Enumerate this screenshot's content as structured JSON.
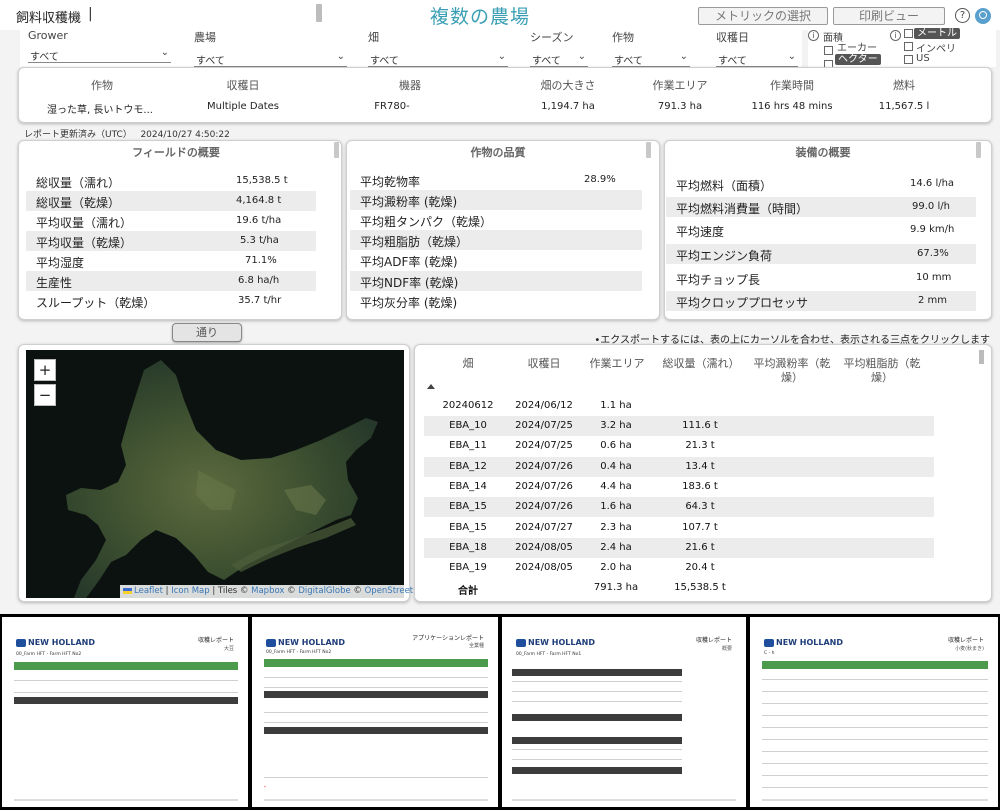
{
  "header": {
    "app_name": "飼料収穫機",
    "separator": "|",
    "page_title": "複数の農場",
    "metric_button": "メトリックの選択",
    "print_button": "印刷ビュー",
    "help": "?"
  },
  "filters": [
    {
      "label": "Grower",
      "value": "すべて"
    },
    {
      "label": "農場",
      "value": "すべて"
    },
    {
      "label": "畑",
      "value": "すべて"
    },
    {
      "label": "シーズン",
      "value": "すべて"
    },
    {
      "label": "作物",
      "value": "すべて"
    },
    {
      "label": "収穫日",
      "value": "すべて"
    }
  ],
  "area_units": {
    "label": "面積",
    "options": [
      {
        "label": "エーカー",
        "selected": false
      },
      {
        "label": "ヘクター",
        "selected": true
      }
    ]
  },
  "length_units": {
    "options": [
      {
        "label": "メートル",
        "selected": true
      },
      {
        "label": "インペリ",
        "selected": false
      },
      {
        "label": "US",
        "selected": false
      }
    ]
  },
  "summary": {
    "headers": [
      "作物",
      "収穫日",
      "機器",
      "畑の大きさ",
      "作業エリア",
      "作業時間",
      "燃料"
    ],
    "values": [
      "湿った草, 長いトウモ...",
      "Multiple Dates",
      "FR780-",
      "1,194.7 ha",
      "791.3 ha",
      "116 hrs 48 mins",
      "11,567.5 l"
    ]
  },
  "updated": {
    "label": "レポート更新済み（UTC）",
    "value": "2024/10/27 4:50:22"
  },
  "field_overview": {
    "title": "フィールドの概要",
    "rows": [
      {
        "k": "総収量（濡れ）",
        "v": "15,538.5 t"
      },
      {
        "k": "総収量（乾燥）",
        "v": "4,164.8 t"
      },
      {
        "k": "平均収量（濡れ）",
        "v": "19.6 t/ha"
      },
      {
        "k": "平均収量（乾燥）",
        "v": "5.3 t/ha"
      },
      {
        "k": "平均湿度",
        "v": "71.1%"
      },
      {
        "k": "生産性",
        "v": "6.8 ha/h"
      },
      {
        "k": "スループット（乾燥）",
        "v": "35.7 t/hr"
      }
    ]
  },
  "crop_quality": {
    "title": "作物の品質",
    "rows": [
      {
        "k": "平均乾物率",
        "v": "28.9%"
      },
      {
        "k": "平均澱粉率 (乾燥)",
        "v": ""
      },
      {
        "k": "平均粗タンパク（乾燥）",
        "v": ""
      },
      {
        "k": "平均粗脂肪（乾燥）",
        "v": ""
      },
      {
        "k": "平均ADF率 (乾燥)",
        "v": ""
      },
      {
        "k": "平均NDF率 (乾燥)",
        "v": ""
      },
      {
        "k": "平均灰分率 (乾燥)",
        "v": ""
      }
    ]
  },
  "equipment": {
    "title": "装備の概要",
    "rows": [
      {
        "k": "平均燃料（面積）",
        "v": "14.6 l/ha"
      },
      {
        "k": "平均燃料消費量（時間）",
        "v": "99.0 l/h"
      },
      {
        "k": "平均速度",
        "v": "9.9 km/h"
      },
      {
        "k": "平均エンジン負荷",
        "v": "67.3%"
      },
      {
        "k": "平均チョップ長",
        "v": "10 mm"
      },
      {
        "k": "平均クロッププロセッサ",
        "v": "2 mm"
      }
    ]
  },
  "passes_button": "通り",
  "export_note": "•エクスポートするには、表の上にカーソルを合わせ、表示される三点をクリックします",
  "map": {
    "zoom_in": "+",
    "zoom_out": "−",
    "attrib_leaflet": "Leaflet",
    "attrib_sep1": " | ",
    "attrib_iconmap": "Icon Map",
    "attrib_tiles": " | Tiles © ",
    "attrib_mapbox": "Mapbox",
    "attrib_copy1": " © ",
    "attrib_dg": "DigitalGlobe",
    "attrib_copy2": " © ",
    "attrib_osm": "OpenStreetMap"
  },
  "field_table": {
    "headers": [
      "畑",
      "収穫日",
      "作業エリア",
      "総収量（濡れ）",
      "平均澱粉率（乾燥）",
      "平均粗脂肪（乾燥）"
    ],
    "rows": [
      [
        "20240612",
        "2024/06/12",
        "1.1 ha",
        ""
      ],
      [
        "EBA_10",
        "2024/07/25",
        "3.2 ha",
        "111.6 t"
      ],
      [
        "EBA_11",
        "2024/07/25",
        "0.6 ha",
        "21.3 t"
      ],
      [
        "EBA_12",
        "2024/07/26",
        "0.4 ha",
        "13.4 t"
      ],
      [
        "EBA_14",
        "2024/07/26",
        "4.4 ha",
        "183.6 t"
      ],
      [
        "EBA_15",
        "2024/07/26",
        "1.6 ha",
        "64.3 t"
      ],
      [
        "EBA_15",
        "2024/07/27",
        "2.3 ha",
        "107.7 t"
      ],
      [
        "EBA_18",
        "2024/08/05",
        "2.4 ha",
        "21.6 t"
      ],
      [
        "EBA_19",
        "2024/08/05",
        "2.0 ha",
        "20.4 t"
      ]
    ],
    "total": [
      "合計",
      "",
      "791.3 ha",
      "15,538.5 t"
    ]
  },
  "reports": [
    {
      "brand": "NEW HOLLAND",
      "title": "収穫レポート",
      "sub": "大豆",
      "farm": "00_Farm HFT - Farm HFT No2"
    },
    {
      "brand": "NEW HOLLAND",
      "title": "アプリケーションレポート",
      "sub": "全業種",
      "farm": "00_Farm HFT - Farm HFT No2"
    },
    {
      "brand": "NEW HOLLAND",
      "title": "収穫レポート",
      "sub": "概要",
      "farm": "00_Farm HFT - Farm HFT No1"
    },
    {
      "brand": "NEW HOLLAND",
      "title": "収穫レポート",
      "sub": "小麦(秋まき)",
      "farm": "C - h"
    }
  ]
}
